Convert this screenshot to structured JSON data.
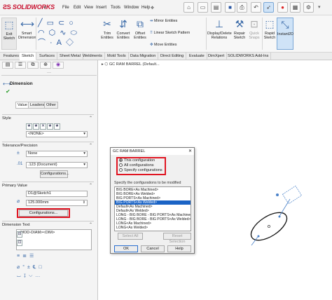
{
  "app": {
    "logo": "SOLIDWORKS",
    "menu": [
      "File",
      "Edit",
      "View",
      "Insert",
      "Tools",
      "Window",
      "Help"
    ]
  },
  "ribbon": {
    "exit_sketch": "Exit Sketch",
    "smart_dimension": "Smart Dimension",
    "trim_entities": "Trim Entities",
    "convert_entities": "Convert Entities",
    "offset_entities": "Offset Entities",
    "mirror_entities": "Mirror Entities",
    "linear_pattern": "Linear Sketch Pattern",
    "move_entities": "Move Entities",
    "display_delete": "Display/Delete Relations",
    "repair_sketch": "Repair Sketch",
    "quick_snaps": "Quick Snaps",
    "rapid_sketch": "Rapid Sketch",
    "instant2d": "Instant2D"
  },
  "tabs": [
    "Features",
    "Sketch",
    "Surfaces",
    "Sheet Metal",
    "Weldments",
    "Mold Tools",
    "Data Migration",
    "Direct Editing",
    "Evaluate",
    "DimXpert",
    "SOLIDWORKS Add-Ins"
  ],
  "panel": {
    "title": "Dimension",
    "subtabs": [
      "Value",
      "Leaders",
      "Other"
    ],
    "style_label": "Style",
    "style_value": "<NONE>",
    "tolerance_label": "Tolerance/Precision",
    "tol_type": "None",
    "precision": ".123 (Document)",
    "config_btn1": "Configurations...",
    "primary_label": "Primary Value",
    "dim_name": "D1@Sketch1",
    "dim_value": "125.000mm",
    "config_btn2": "Configurations...",
    "dimtext_label": "Dimension Text",
    "dimtext_value": "<MOD-DIAM><DIM>"
  },
  "canvas": {
    "tree_item": "GC RAM BARREL  (Default..."
  },
  "dialog": {
    "title": "GC RAM BARREL",
    "opt_this": "This configuration",
    "opt_all": "All configurations",
    "opt_specify": "Specify configurations",
    "specify_label": "Specify the configurations to be modified",
    "items": [
      "BIG BORE<As Machined>",
      "BIG BORE<As Welded>",
      "BIG PORTS<As Machined>",
      "BIG PORTS<As Welded>",
      "Default<As Machined>",
      "Default<As Welded>",
      "LONG - BIG BORE - BIG PORTS<As Machined>",
      "LONG - BIG BORE - BIG PORTS<As Welded>",
      "LONG<As Machined>",
      "LONG<As Welded>"
    ],
    "select_all": "Select All",
    "reset": "Reset Selection",
    "ok": "OK",
    "cancel": "Cancel",
    "help": "Help"
  },
  "colors": {
    "highlight": "#e01522",
    "selection": "#1a63c5"
  }
}
